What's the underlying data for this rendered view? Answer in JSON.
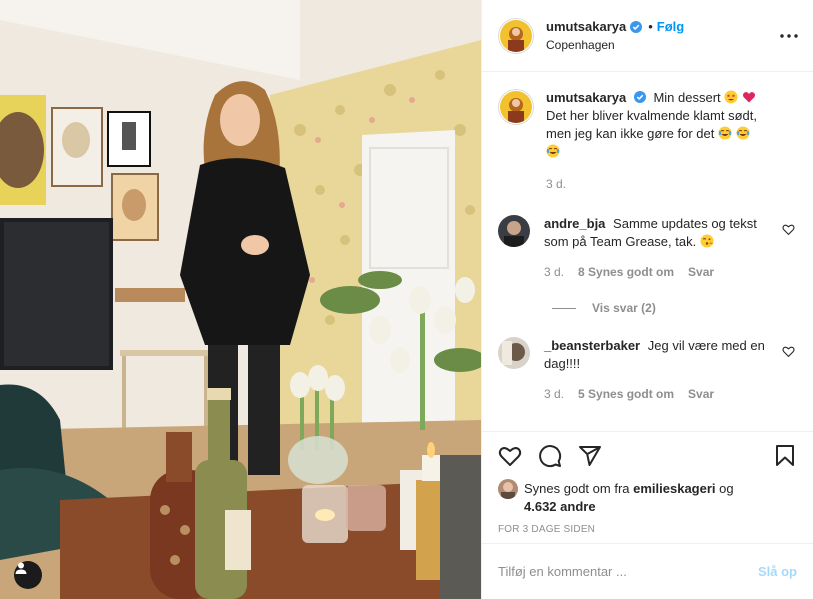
{
  "post": {
    "author": {
      "username": "umutsakarya",
      "verified": true,
      "location": "Copenhagen",
      "follow_label": "Følg",
      "dot": "•"
    },
    "more_icon": "more-horizontal-icon",
    "caption": {
      "username": "umutsakarya",
      "line1": "Min dessert",
      "line2": "Det her bliver kvalmende klamt sødt,",
      "line3": "men jeg kan ikke gøre for det",
      "emojis_after_line1": [
        "star-struck-emoji",
        "red-heart-emoji"
      ],
      "emojis_after_line3": [
        "tears-of-joy-emoji",
        "tears-of-joy-emoji",
        "tears-of-joy-emoji"
      ],
      "time": "3 d."
    },
    "comments": [
      {
        "username": "andre_bja",
        "text": "Samme updates og tekst som på Team Grease, tak.",
        "emoji": "kissing-heart-emoji",
        "time": "3 d.",
        "likes": "8 Synes godt om",
        "reply_label": "Svar",
        "view_replies": "Vis svar (2)"
      },
      {
        "username": "_beansterbaker",
        "text": "Jeg vil være med en dag!!!!",
        "time": "3 d.",
        "likes": "5 Synes godt om",
        "reply_label": "Svar"
      }
    ],
    "likes": {
      "prefix": "Synes godt om fra",
      "user": "emilieskageri",
      "connector": "og",
      "others": "4.632 andre"
    },
    "timestamp": "FOR 3 DAGE SIDEN",
    "add_comment": {
      "placeholder": "Tilføj en kommentar ...",
      "post_label": "Slå op"
    }
  },
  "colors": {
    "accent": "#0095f6",
    "text": "#262626",
    "muted": "#8e8e8e",
    "border": "#efefef",
    "verified": "#3897f0"
  }
}
